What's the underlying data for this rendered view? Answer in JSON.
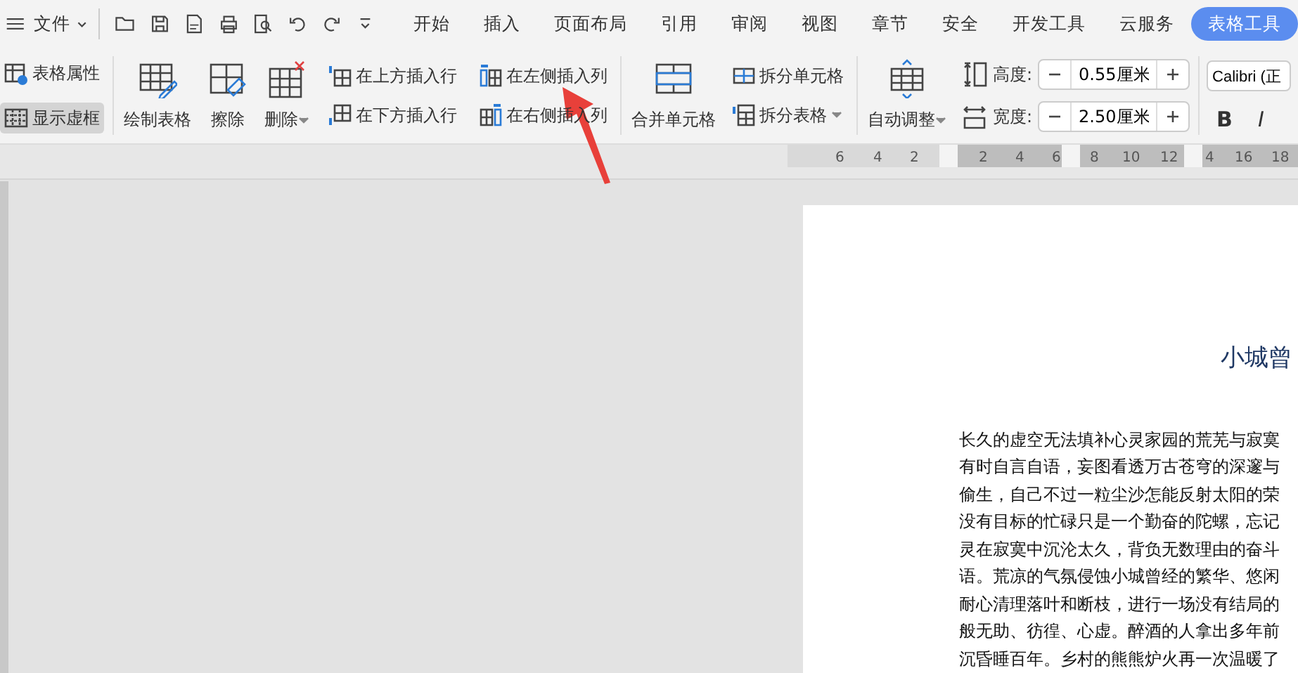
{
  "menu_bar": {
    "file_menu": "文件",
    "tabs": [
      {
        "label": "开始",
        "selected": false
      },
      {
        "label": "插入",
        "selected": false
      },
      {
        "label": "页面布局",
        "selected": false
      },
      {
        "label": "引用",
        "selected": false
      },
      {
        "label": "审阅",
        "selected": false
      },
      {
        "label": "视图",
        "selected": false
      },
      {
        "label": "章节",
        "selected": false
      },
      {
        "label": "安全",
        "selected": false
      },
      {
        "label": "开发工具",
        "selected": false
      },
      {
        "label": "云服务",
        "selected": false
      },
      {
        "label": "表格工具",
        "selected": true
      }
    ]
  },
  "ribbon": {
    "view_options": [
      {
        "label": "表格属性",
        "selected": false
      },
      {
        "label": "显示虚框",
        "selected": true
      }
    ],
    "draw_buttons": [
      {
        "label": "绘制表格",
        "dropdown": false
      },
      {
        "label": "擦除",
        "dropdown": false
      },
      {
        "label": "删除",
        "dropdown": true
      }
    ],
    "insert_rows": [
      "在上方插入行",
      "在下方插入行"
    ],
    "insert_columns": [
      "在左侧插入列",
      "在右侧插入列"
    ],
    "merge_button": "合并单元格",
    "split_buttons": [
      {
        "label": "拆分单元格",
        "dropdown": false
      },
      {
        "label": "拆分表格",
        "dropdown": true
      }
    ],
    "autofit_button": "自动调整",
    "size_fields": [
      {
        "label": "高度:",
        "value": "0.55厘米"
      },
      {
        "label": "宽度:",
        "value": "2.50厘米"
      }
    ],
    "font_field": "Calibri (正",
    "format_buttons": [
      "B",
      "I"
    ]
  },
  "ruler": {
    "numbers": [
      "6",
      "4",
      "2",
      "2",
      "4",
      "6",
      "8",
      "10",
      "12",
      "4",
      "16",
      "18"
    ]
  },
  "document": {
    "title": "小城曾",
    "lines": [
      "长久的虚空无法填补心灵家园的荒芜与寂寞",
      "有时自言自语，妄图看透万古苍穹的深邃与",
      "偷生，自己不过一粒尘沙怎能反射太阳的荣",
      "没有目标的忙碌只是一个勤奋的陀螺，忘记",
      "灵在寂寞中沉沦太久，背负无数理由的奋斗",
      "语。荒凉的气氛侵蚀小城曾经的繁华、悠闲",
      "耐心清理落叶和断枝，进行一场没有结局的",
      "般无助、彷徨、心虚。醉酒的人拿出多年前",
      "沉昏睡百年。乡村的熊熊炉火再一次温暖了"
    ]
  }
}
